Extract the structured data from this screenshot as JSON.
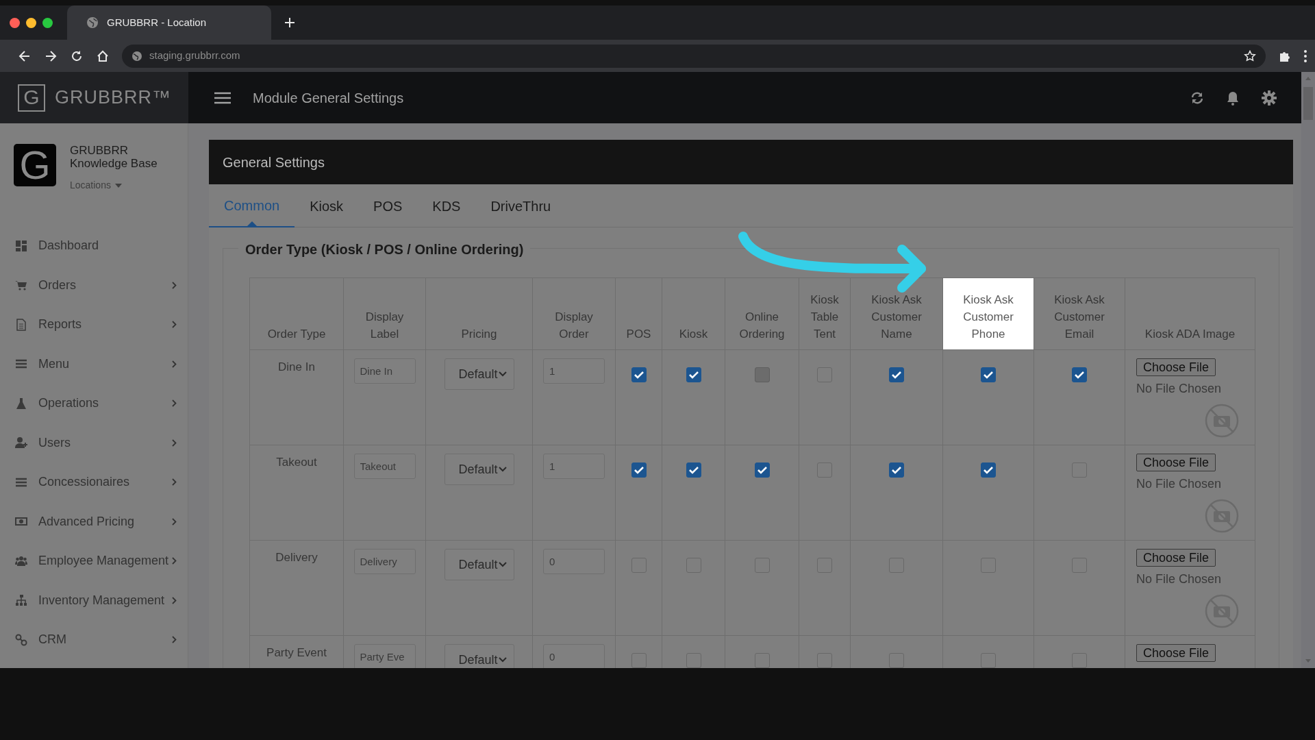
{
  "browser": {
    "tab_title": "GRUBBRR - Location",
    "url": "staging.grubbrr.com"
  },
  "app": {
    "logo_mark": "G",
    "logo_text": "GRUBBRR™",
    "page_title": "Module General Settings"
  },
  "sidebar": {
    "org": {
      "logo_mark": "G",
      "name": "GRUBBRR",
      "subtitle": "Knowledge Base",
      "switcher": "Locations"
    },
    "items": [
      {
        "label": "Dashboard",
        "has_submenu": false
      },
      {
        "label": "Orders",
        "has_submenu": true
      },
      {
        "label": "Reports",
        "has_submenu": true
      },
      {
        "label": "Menu",
        "has_submenu": true
      },
      {
        "label": "Operations",
        "has_submenu": true
      },
      {
        "label": "Users",
        "has_submenu": true
      },
      {
        "label": "Concessionaires",
        "has_submenu": true
      },
      {
        "label": "Advanced Pricing",
        "has_submenu": true
      },
      {
        "label": "Employee Management",
        "has_submenu": true
      },
      {
        "label": "Inventory Management",
        "has_submenu": true
      },
      {
        "label": "CRM",
        "has_submenu": true
      }
    ]
  },
  "panel": {
    "title": "General Settings",
    "tabs": [
      {
        "label": "Common",
        "selected": true
      },
      {
        "label": "Kiosk",
        "selected": false
      },
      {
        "label": "POS",
        "selected": false
      },
      {
        "label": "KDS",
        "selected": false
      },
      {
        "label": "DriveThru",
        "selected": false
      }
    ],
    "section": {
      "legend": "Order Type (Kiosk / POS / Online Ordering)",
      "columns": [
        {
          "label": "Order Type",
          "highlighted": false
        },
        {
          "label": "Display Label",
          "highlighted": false
        },
        {
          "label": "Pricing",
          "highlighted": false
        },
        {
          "label": "Display Order",
          "highlighted": false
        },
        {
          "label": "POS",
          "highlighted": false
        },
        {
          "label": "Kiosk",
          "highlighted": false
        },
        {
          "label": "Online Ordering",
          "highlighted": false
        },
        {
          "label": "Kiosk Table Tent",
          "highlighted": false
        },
        {
          "label": "Kiosk Ask Customer Name",
          "highlighted": false
        },
        {
          "label": "Kiosk Ask Customer Phone",
          "highlighted": true
        },
        {
          "label": "Kiosk Ask Customer Email",
          "highlighted": false
        },
        {
          "label": "Kiosk ADA Image",
          "highlighted": false
        }
      ],
      "rows": [
        {
          "order_type": "Dine In",
          "display_label": "Dine In",
          "pricing": "Default",
          "display_order": "1",
          "checks": [
            {
              "checked": true,
              "disabled": false
            },
            {
              "checked": true,
              "disabled": false
            },
            {
              "checked": false,
              "disabled": true
            },
            {
              "checked": false,
              "disabled": false
            },
            {
              "checked": true,
              "disabled": false
            },
            {
              "checked": true,
              "disabled": false
            },
            {
              "checked": true,
              "disabled": false
            }
          ],
          "file_button": "Choose File",
          "file_status": "No File Chosen"
        },
        {
          "order_type": "Takeout",
          "display_label": "Takeout",
          "pricing": "Default",
          "display_order": "1",
          "checks": [
            {
              "checked": true,
              "disabled": false
            },
            {
              "checked": true,
              "disabled": false
            },
            {
              "checked": true,
              "disabled": false
            },
            {
              "checked": false,
              "disabled": false
            },
            {
              "checked": true,
              "disabled": false
            },
            {
              "checked": true,
              "disabled": false
            },
            {
              "checked": false,
              "disabled": false
            }
          ],
          "file_button": "Choose File",
          "file_status": "No File Chosen"
        },
        {
          "order_type": "Delivery",
          "display_label": "Delivery",
          "pricing": "Default",
          "display_order": "0",
          "checks": [
            {
              "checked": false,
              "disabled": false
            },
            {
              "checked": false,
              "disabled": false
            },
            {
              "checked": false,
              "disabled": false
            },
            {
              "checked": false,
              "disabled": false
            },
            {
              "checked": false,
              "disabled": false
            },
            {
              "checked": false,
              "disabled": false
            },
            {
              "checked": false,
              "disabled": false
            }
          ],
          "file_button": "Choose File",
          "file_status": "No File Chosen"
        },
        {
          "order_type": "Party Event",
          "display_label": "Party Eve",
          "pricing": "Default",
          "display_order": "0",
          "checks": [
            {
              "checked": false,
              "disabled": false
            },
            {
              "checked": false,
              "disabled": false
            },
            {
              "checked": false,
              "disabled": false
            },
            {
              "checked": false,
              "disabled": false
            },
            {
              "checked": false,
              "disabled": false
            },
            {
              "checked": false,
              "disabled": false
            },
            {
              "checked": false,
              "disabled": false
            }
          ],
          "file_button": "Choose File"
        }
      ]
    }
  }
}
